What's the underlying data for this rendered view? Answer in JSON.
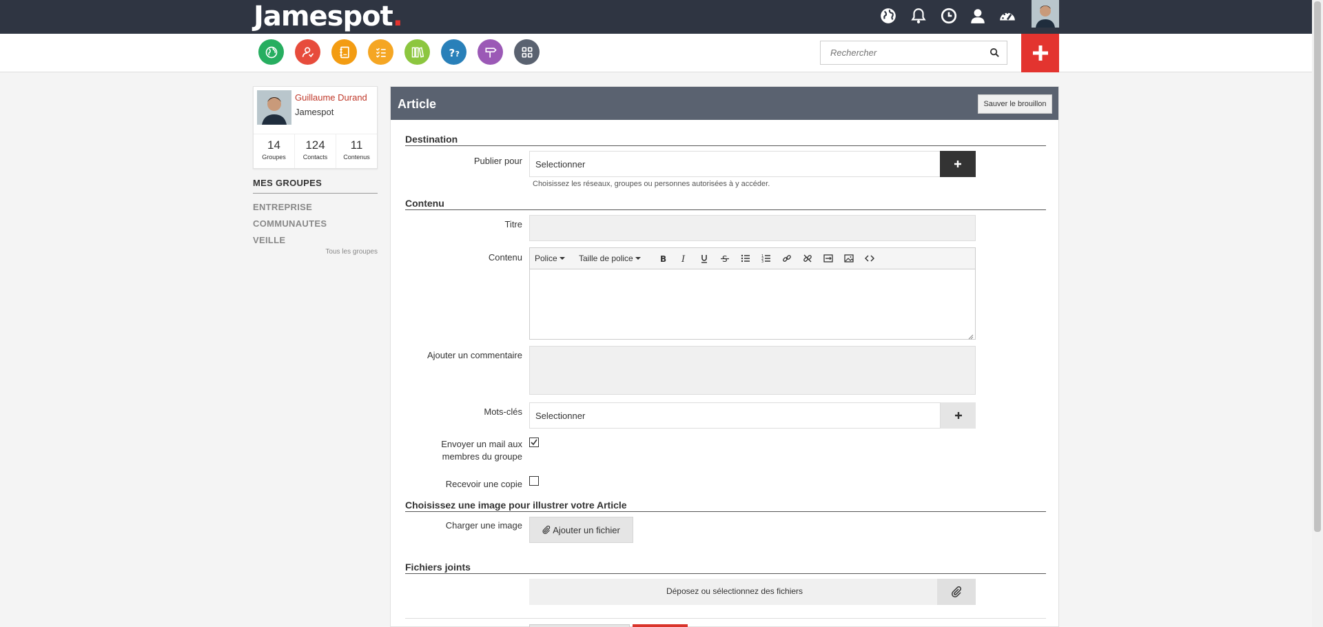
{
  "header": {
    "logo_text": "Jamespot",
    "top_icons": [
      "globe-icon",
      "bell-icon",
      "clock-icon",
      "user-icon",
      "dashboard-icon"
    ]
  },
  "appbar": {
    "apps": [
      {
        "name": "globe-app",
        "color": "#27ae60"
      },
      {
        "name": "contacts-app",
        "color": "#e74c3c"
      },
      {
        "name": "notebook-app",
        "color": "#f39c12"
      },
      {
        "name": "tasks-app",
        "color": "#f5a623"
      },
      {
        "name": "library-app",
        "color": "#8cc63f"
      },
      {
        "name": "faq-app",
        "color": "#2980b9"
      },
      {
        "name": "signpost-app",
        "color": "#9b59b6"
      },
      {
        "name": "apps-grid",
        "color": "#5a6270"
      }
    ],
    "search_placeholder": "Rechercher"
  },
  "profile": {
    "name": "Guillaume Durand",
    "company": "Jamespot",
    "stats": [
      {
        "value": "14",
        "label": "Groupes"
      },
      {
        "value": "124",
        "label": "Contacts"
      },
      {
        "value": "11",
        "label": "Contenus"
      }
    ]
  },
  "groups": {
    "title": "MES GROUPES",
    "items": [
      "ENTREPRISE",
      "COMMUNAUTES",
      "VEILLE"
    ],
    "all_link": "Tous les groupes"
  },
  "article": {
    "title": "Article",
    "save_draft": "Sauver le brouillon",
    "sections": {
      "destination": "Destination",
      "content": "Contenu",
      "image": "Choisissez une image pour illustrer votre Article",
      "files": "Fichiers joints"
    },
    "labels": {
      "publish_for": "Publier pour",
      "title": "Titre",
      "content": "Contenu",
      "comment": "Ajouter un commentaire",
      "keywords": "Mots-clés",
      "send_mail": "Envoyer un mail aux membres du groupe",
      "receive_copy": "Recevoir une copie",
      "upload_image": "Charger une image"
    },
    "publish_select": "Selectionner",
    "publish_help": "Choisissez les réseaux, groupes ou personnes autorisées à y accéder.",
    "keywords_select": "Selectionner",
    "toolbar": {
      "font": "Police",
      "font_size": "Taille de police"
    },
    "send_mail_checked": true,
    "receive_copy_checked": false,
    "add_file": "Ajouter un fichier",
    "drop_files": "Déposez ou sélectionnez des fichiers"
  }
}
